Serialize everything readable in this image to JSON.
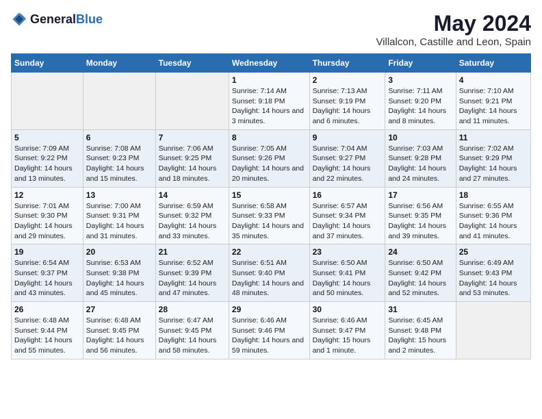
{
  "header": {
    "logo_general": "General",
    "logo_blue": "Blue",
    "title": "May 2024",
    "subtitle": "Villalcon, Castille and Leon, Spain"
  },
  "columns": [
    "Sunday",
    "Monday",
    "Tuesday",
    "Wednesday",
    "Thursday",
    "Friday",
    "Saturday"
  ],
  "weeks": [
    [
      {
        "day": "",
        "sunrise": "",
        "sunset": "",
        "daylight": ""
      },
      {
        "day": "",
        "sunrise": "",
        "sunset": "",
        "daylight": ""
      },
      {
        "day": "",
        "sunrise": "",
        "sunset": "",
        "daylight": ""
      },
      {
        "day": "1",
        "sunrise": "Sunrise: 7:14 AM",
        "sunset": "Sunset: 9:18 PM",
        "daylight": "Daylight: 14 hours and 3 minutes."
      },
      {
        "day": "2",
        "sunrise": "Sunrise: 7:13 AM",
        "sunset": "Sunset: 9:19 PM",
        "daylight": "Daylight: 14 hours and 6 minutes."
      },
      {
        "day": "3",
        "sunrise": "Sunrise: 7:11 AM",
        "sunset": "Sunset: 9:20 PM",
        "daylight": "Daylight: 14 hours and 8 minutes."
      },
      {
        "day": "4",
        "sunrise": "Sunrise: 7:10 AM",
        "sunset": "Sunset: 9:21 PM",
        "daylight": "Daylight: 14 hours and 11 minutes."
      }
    ],
    [
      {
        "day": "5",
        "sunrise": "Sunrise: 7:09 AM",
        "sunset": "Sunset: 9:22 PM",
        "daylight": "Daylight: 14 hours and 13 minutes."
      },
      {
        "day": "6",
        "sunrise": "Sunrise: 7:08 AM",
        "sunset": "Sunset: 9:23 PM",
        "daylight": "Daylight: 14 hours and 15 minutes."
      },
      {
        "day": "7",
        "sunrise": "Sunrise: 7:06 AM",
        "sunset": "Sunset: 9:25 PM",
        "daylight": "Daylight: 14 hours and 18 minutes."
      },
      {
        "day": "8",
        "sunrise": "Sunrise: 7:05 AM",
        "sunset": "Sunset: 9:26 PM",
        "daylight": "Daylight: 14 hours and 20 minutes."
      },
      {
        "day": "9",
        "sunrise": "Sunrise: 7:04 AM",
        "sunset": "Sunset: 9:27 PM",
        "daylight": "Daylight: 14 hours and 22 minutes."
      },
      {
        "day": "10",
        "sunrise": "Sunrise: 7:03 AM",
        "sunset": "Sunset: 9:28 PM",
        "daylight": "Daylight: 14 hours and 24 minutes."
      },
      {
        "day": "11",
        "sunrise": "Sunrise: 7:02 AM",
        "sunset": "Sunset: 9:29 PM",
        "daylight": "Daylight: 14 hours and 27 minutes."
      }
    ],
    [
      {
        "day": "12",
        "sunrise": "Sunrise: 7:01 AM",
        "sunset": "Sunset: 9:30 PM",
        "daylight": "Daylight: 14 hours and 29 minutes."
      },
      {
        "day": "13",
        "sunrise": "Sunrise: 7:00 AM",
        "sunset": "Sunset: 9:31 PM",
        "daylight": "Daylight: 14 hours and 31 minutes."
      },
      {
        "day": "14",
        "sunrise": "Sunrise: 6:59 AM",
        "sunset": "Sunset: 9:32 PM",
        "daylight": "Daylight: 14 hours and 33 minutes."
      },
      {
        "day": "15",
        "sunrise": "Sunrise: 6:58 AM",
        "sunset": "Sunset: 9:33 PM",
        "daylight": "Daylight: 14 hours and 35 minutes."
      },
      {
        "day": "16",
        "sunrise": "Sunrise: 6:57 AM",
        "sunset": "Sunset: 9:34 PM",
        "daylight": "Daylight: 14 hours and 37 minutes."
      },
      {
        "day": "17",
        "sunrise": "Sunrise: 6:56 AM",
        "sunset": "Sunset: 9:35 PM",
        "daylight": "Daylight: 14 hours and 39 minutes."
      },
      {
        "day": "18",
        "sunrise": "Sunrise: 6:55 AM",
        "sunset": "Sunset: 9:36 PM",
        "daylight": "Daylight: 14 hours and 41 minutes."
      }
    ],
    [
      {
        "day": "19",
        "sunrise": "Sunrise: 6:54 AM",
        "sunset": "Sunset: 9:37 PM",
        "daylight": "Daylight: 14 hours and 43 minutes."
      },
      {
        "day": "20",
        "sunrise": "Sunrise: 6:53 AM",
        "sunset": "Sunset: 9:38 PM",
        "daylight": "Daylight: 14 hours and 45 minutes."
      },
      {
        "day": "21",
        "sunrise": "Sunrise: 6:52 AM",
        "sunset": "Sunset: 9:39 PM",
        "daylight": "Daylight: 14 hours and 47 minutes."
      },
      {
        "day": "22",
        "sunrise": "Sunrise: 6:51 AM",
        "sunset": "Sunset: 9:40 PM",
        "daylight": "Daylight: 14 hours and 48 minutes."
      },
      {
        "day": "23",
        "sunrise": "Sunrise: 6:50 AM",
        "sunset": "Sunset: 9:41 PM",
        "daylight": "Daylight: 14 hours and 50 minutes."
      },
      {
        "day": "24",
        "sunrise": "Sunrise: 6:50 AM",
        "sunset": "Sunset: 9:42 PM",
        "daylight": "Daylight: 14 hours and 52 minutes."
      },
      {
        "day": "25",
        "sunrise": "Sunrise: 6:49 AM",
        "sunset": "Sunset: 9:43 PM",
        "daylight": "Daylight: 14 hours and 53 minutes."
      }
    ],
    [
      {
        "day": "26",
        "sunrise": "Sunrise: 6:48 AM",
        "sunset": "Sunset: 9:44 PM",
        "daylight": "Daylight: 14 hours and 55 minutes."
      },
      {
        "day": "27",
        "sunrise": "Sunrise: 6:48 AM",
        "sunset": "Sunset: 9:45 PM",
        "daylight": "Daylight: 14 hours and 56 minutes."
      },
      {
        "day": "28",
        "sunrise": "Sunrise: 6:47 AM",
        "sunset": "Sunset: 9:45 PM",
        "daylight": "Daylight: 14 hours and 58 minutes."
      },
      {
        "day": "29",
        "sunrise": "Sunrise: 6:46 AM",
        "sunset": "Sunset: 9:46 PM",
        "daylight": "Daylight: 14 hours and 59 minutes."
      },
      {
        "day": "30",
        "sunrise": "Sunrise: 6:46 AM",
        "sunset": "Sunset: 9:47 PM",
        "daylight": "Daylight: 15 hours and 1 minute."
      },
      {
        "day": "31",
        "sunrise": "Sunrise: 6:45 AM",
        "sunset": "Sunset: 9:48 PM",
        "daylight": "Daylight: 15 hours and 2 minutes."
      },
      {
        "day": "",
        "sunrise": "",
        "sunset": "",
        "daylight": ""
      }
    ]
  ]
}
